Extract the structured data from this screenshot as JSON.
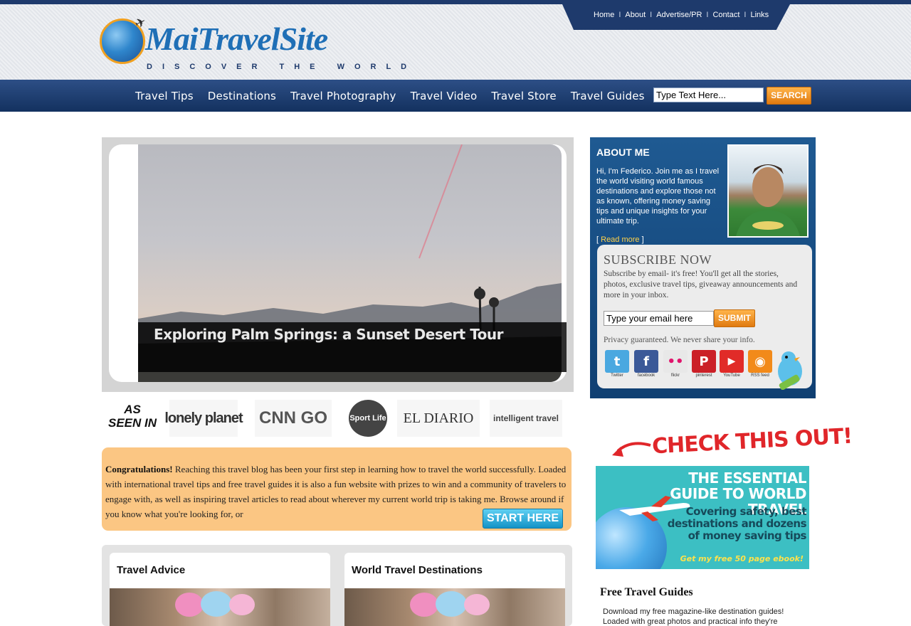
{
  "header": {
    "logo": {
      "brand": "MaiTravelSite",
      "tagline": "DISCOVER THE WORLD"
    },
    "top_links": [
      "Home",
      "About",
      "Advertise/PR",
      "Contact",
      "Links"
    ],
    "nav": [
      "Travel Tips",
      "Destinations",
      "Travel Photography",
      "Travel Video",
      "Travel Store",
      "Travel Guides"
    ],
    "search": {
      "value": "Type Text Here...",
      "button": "SEARCH"
    }
  },
  "slider": {
    "caption": "Exploring Palm Springs: a Sunset Desert Tour"
  },
  "as_seen_in": {
    "label_line1": "AS",
    "label_line2": "SEEN IN",
    "logos": [
      "lonely planet",
      "CNN GO",
      "Sport Life",
      "EL DIARIO",
      "intelligent travel"
    ]
  },
  "congrats": {
    "lead": "Congratulations!",
    "text": " Reaching this travel blog has been your first step in learning how to travel the world successfully. Loaded with international travel tips and free travel guides it is also a fun website with prizes to win and a community of travelers to engage with, as well as inspiring travel articles to read about wherever my current world trip is taking me. Browse around if you know what you're looking for, or",
    "button": "START HERE"
  },
  "cards": [
    {
      "title": "Travel Advice"
    },
    {
      "title": "World Travel Destinations"
    }
  ],
  "about": {
    "title": "ABOUT ME",
    "text": "Hi, I'm Federico. Join me as I travel the world visiting world famous destinations and explore those not as known, offering money saving tips and unique insights for your ultimate trip.",
    "read_more": "Read more"
  },
  "subscribe": {
    "title": "SUBSCRIBE NOW",
    "text": "Subscribe by email- it's free! You'll get all the stories, photos, exclusive travel tips, giveaway announcements and more in your inbox.",
    "input_value": "Type your email here",
    "button": "SUBMIT",
    "privacy": "Privacy guaranteed. We never share your info."
  },
  "social": [
    {
      "name": "twitter",
      "label": "Twitter",
      "color": "#4aa8e0",
      "glyph": "t"
    },
    {
      "name": "facebook",
      "label": "facebook",
      "color": "#3b5998",
      "glyph": "f"
    },
    {
      "name": "flickr",
      "label": "flickr",
      "color": "#e8e8e8",
      "glyph": "••"
    },
    {
      "name": "pinterest",
      "label": "pinterest",
      "color": "#cb2027",
      "glyph": "P"
    },
    {
      "name": "youtube",
      "label": "YouTube",
      "color": "#e12b28",
      "glyph": "▶"
    },
    {
      "name": "rss",
      "label": "RSS feed",
      "color": "#f28a1a",
      "glyph": "◉"
    }
  ],
  "promo": {
    "check": "CHECK THIS OUT!",
    "guide_title": "THE ESSENTIAL GUIDE TO WORLD TRAVEL",
    "guide_sub": "Covering safety, best destinations and dozens of money saving tips",
    "guide_cta": "Get my free 50 page ebook!"
  },
  "free_guides": {
    "title": "Free Travel Guides",
    "text": "Download my free magazine-like destination guides! Loaded with great photos and practical info they're"
  },
  "colors": {
    "nav": "#1e3a6c",
    "accent": "#e07a10",
    "congrats_bg": "#fbc683",
    "about_bg": "#1f5a92"
  }
}
